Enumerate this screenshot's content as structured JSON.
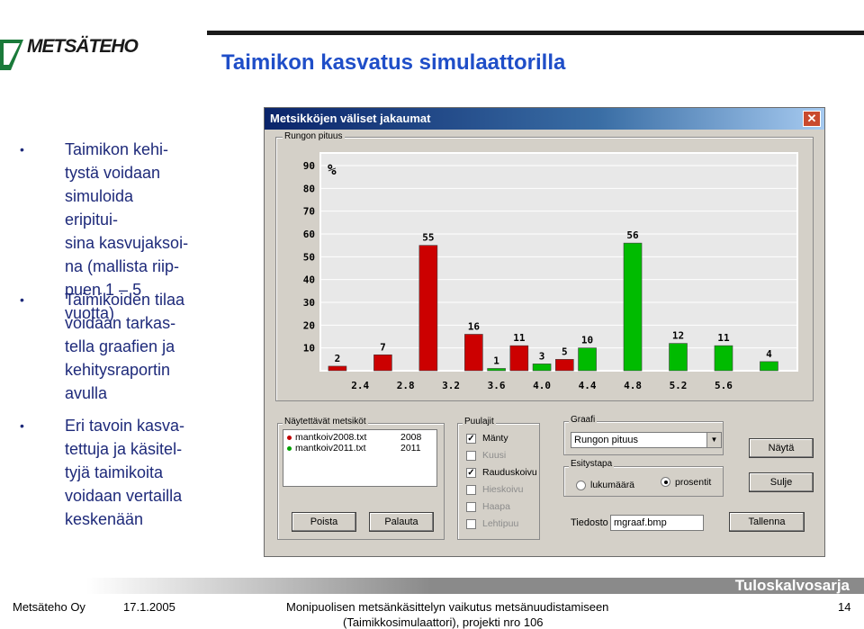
{
  "header": {
    "logo_text": "METSÄTEHO",
    "title": "Taimikon kasvatus simulaattorilla"
  },
  "bullets": [
    "Taimikon kehi-\ntystä voidaan\nsimuloida eripitui-\nsina kasvujaksoi-\nna (mallista riip-\npuen 1 – 5 vuotta)",
    "Taimikoiden tilaa\nvoidaan tarkas-\ntella graafien ja\nkehitysraportin\navulla",
    "Eri tavoin kasva-\ntettuja ja käsitel-\ntyjä taimikoita\nvoidaan vertailla\nkeskenään"
  ],
  "window": {
    "title": "Metsikköjen väliset jakaumat",
    "close_glyph": "✕",
    "chart_group_label": "Rungon pituus",
    "percent_symbol": "%",
    "stands_group_label": "Näytettävät metsiköt",
    "stands": [
      {
        "file": "mantkoiv2008.txt",
        "year": "2008",
        "color": "#c00000"
      },
      {
        "file": "mantkoiv2011.txt",
        "year": "2011",
        "color": "#00a000"
      }
    ],
    "remove_button": "Poista",
    "restore_button": "Palauta",
    "species_group_label": "Puulajit",
    "species": [
      {
        "label": "Mänty",
        "checked": "✓",
        "enabled": true
      },
      {
        "label": "Kuusi",
        "checked": "",
        "enabled": false
      },
      {
        "label": "Rauduskoivu",
        "checked": "✓",
        "enabled": true
      },
      {
        "label": "Hieskoivu",
        "checked": "",
        "enabled": false
      },
      {
        "label": "Haapa",
        "checked": "",
        "enabled": false
      },
      {
        "label": "Lehtipuu",
        "checked": "",
        "enabled": false
      }
    ],
    "graph_group_label": "Graafi",
    "graph_select_value": "Rungon pituus",
    "presentation_group_label": "Esitystapa",
    "radio_count": "lukumäärä",
    "radio_percent": "prosentit",
    "show_button": "Näytä",
    "close_button": "Sulje",
    "file_label": "Tiedosto",
    "file_value": "mgraaf.bmp",
    "save_button": "Tallenna"
  },
  "chart_data": {
    "type": "bar",
    "title": "Rungon pituus",
    "ylabel": "%",
    "ylim": [
      0,
      90
    ],
    "yticks": [
      10,
      20,
      30,
      40,
      50,
      60,
      70,
      80,
      90
    ],
    "xtick_labels": [
      "2.4",
      "2.8",
      "3.2",
      "3.6",
      "4.0",
      "4.4",
      "4.8",
      "5.2",
      "5.6"
    ],
    "series": [
      {
        "year": "2008",
        "color": "#cc0000",
        "bars": [
          {
            "x": 2.2,
            "value": 2
          },
          {
            "x": 2.6,
            "value": 7
          },
          {
            "x": 3.0,
            "value": 55
          },
          {
            "x": 3.4,
            "value": 16
          },
          {
            "x": 3.8,
            "value": 11
          },
          {
            "x": 4.2,
            "value": 5
          }
        ]
      },
      {
        "year": "2011",
        "color": "#00bb00",
        "bars": [
          {
            "x": 3.6,
            "value": 1
          },
          {
            "x": 4.0,
            "value": 3
          },
          {
            "x": 4.4,
            "value": 10
          },
          {
            "x": 4.8,
            "value": 56
          },
          {
            "x": 5.2,
            "value": 12
          },
          {
            "x": 5.6,
            "value": 11
          },
          {
            "x": 6.0,
            "value": 4
          }
        ]
      }
    ]
  },
  "footer": {
    "brand": "Tuloskalvosarja",
    "org": "Metsäteho Oy",
    "date": "17.1.2005",
    "line1": "Monipuolisen metsänkäsittelyn vaikutus metsänuudistamiseen",
    "line2": "(Taimikkosimulaattori), projekti nro 106",
    "page": "14"
  }
}
